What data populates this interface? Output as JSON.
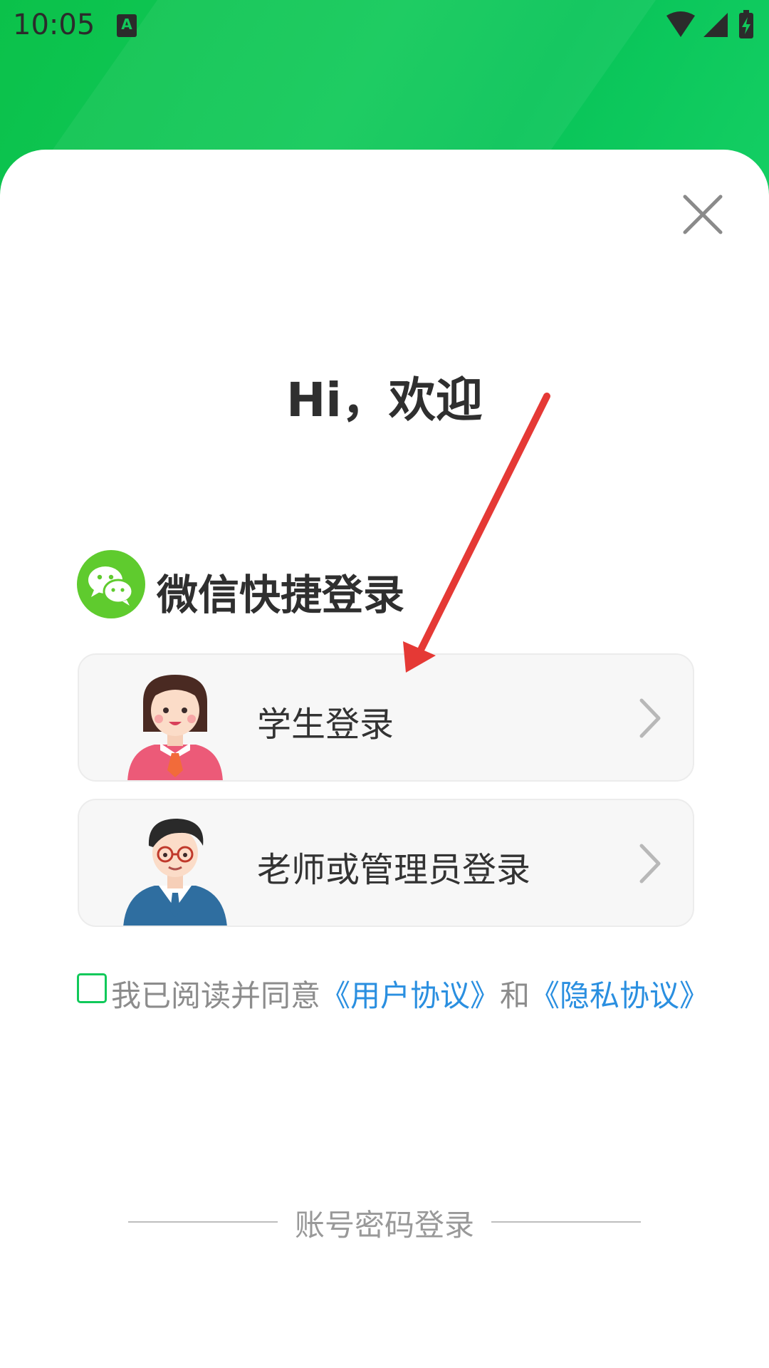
{
  "status_bar": {
    "time": "10:05",
    "icons": [
      "keyboard-a-icon",
      "wifi-icon",
      "cell-signal-icon",
      "battery-charging-icon"
    ]
  },
  "colors": {
    "brand_green": "#11c95a",
    "link_blue": "#2a8fe0",
    "annotation_arrow": "#e53935"
  },
  "title": "Hi，欢迎",
  "wechat_login": {
    "label": "微信快捷登录",
    "icon": "wechat-icon"
  },
  "login_options": [
    {
      "label": "学生登录",
      "avatar": "student-avatar-icon"
    },
    {
      "label": "老师或管理员登录",
      "avatar": "teacher-avatar-icon"
    }
  ],
  "agreement": {
    "checked": false,
    "text": "我已阅读并同意",
    "user_agreement": "《用户协议》",
    "and": "和",
    "privacy_agreement": "《隐私协议》"
  },
  "alt_login": {
    "label": "账号密码登录"
  }
}
